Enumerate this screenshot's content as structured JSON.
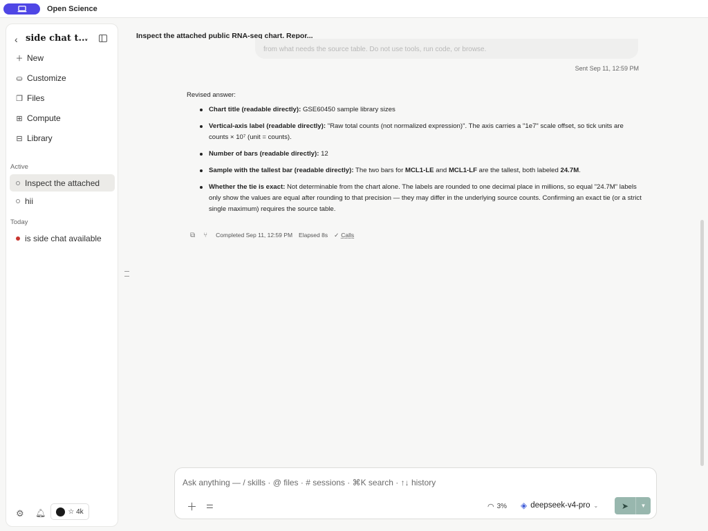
{
  "app": {
    "name": "Open Science"
  },
  "sidebar": {
    "title": "side chat t...",
    "nav": [
      {
        "label": "New",
        "icon": "plus-icon"
      },
      {
        "label": "Customize",
        "icon": "customize-icon"
      },
      {
        "label": "Files",
        "icon": "files-icon"
      },
      {
        "label": "Compute",
        "icon": "compute-icon"
      },
      {
        "label": "Library",
        "icon": "library-icon"
      }
    ],
    "sections": {
      "active_label": "Active",
      "today_label": "Today"
    },
    "active_sessions": [
      {
        "label": "Inspect the attached",
        "status": "idle",
        "selected": true
      },
      {
        "label": "hii",
        "status": "idle",
        "selected": false
      }
    ],
    "today_sessions": [
      {
        "label": "is side chat available",
        "status": "running"
      }
    ],
    "github_stars": "4k"
  },
  "chat": {
    "title": "Inspect the attached public RNA-seq chart. Repor...",
    "previous_message_fragment": "from what needs the source table. Do not use tools, run code, or browse.",
    "sent_time": "Sent Sep 11, 12:59 PM",
    "answer": {
      "lead": "Revised answer:",
      "items": [
        {
          "key": "Chart title (readable directly):",
          "text": " GSE60450 sample library sizes"
        },
        {
          "key": "Vertical-axis label (readable directly):",
          "text": " \"Raw total counts (not normalized expression)\". The axis carries a \"1e7\" scale offset, so tick units are counts × 10⁷ (unit = counts)."
        },
        {
          "key": "Number of bars (readable directly):",
          "text": " 12"
        },
        {
          "key": "Sample with the tallest bar (readable directly):",
          "text_a": " The two bars for ",
          "sample_a": "MCL1-LE",
          "text_b": " and ",
          "sample_b": "MCL1-LF",
          "text_c": " are the tallest, both labeled ",
          "value": "24.7M",
          "text_d": "."
        },
        {
          "key": "Whether the tie is exact:",
          "text": " Not determinable from the chart alone. The labels are rounded to one decimal place in millions, so equal \"24.7M\" labels only show the values are equal after rounding to that precision — they may differ in the underlying source counts. Confirming an exact tie (or a strict single maximum) requires the source table."
        }
      ]
    },
    "meta": {
      "completed": "Completed Sep 11, 12:59 PM",
      "elapsed": "Elapsed 8s",
      "calls": "Calls"
    }
  },
  "composer": {
    "placeholder": "Ask anything — / skills · @ files · # sessions · ⌘K search · ↑↓ history",
    "context_usage": "3%",
    "model": "deepseek-v4-pro"
  },
  "colors": {
    "accent": "#4f46e5",
    "send_button": "#98b7ae",
    "running_dot": "#c8352f"
  }
}
